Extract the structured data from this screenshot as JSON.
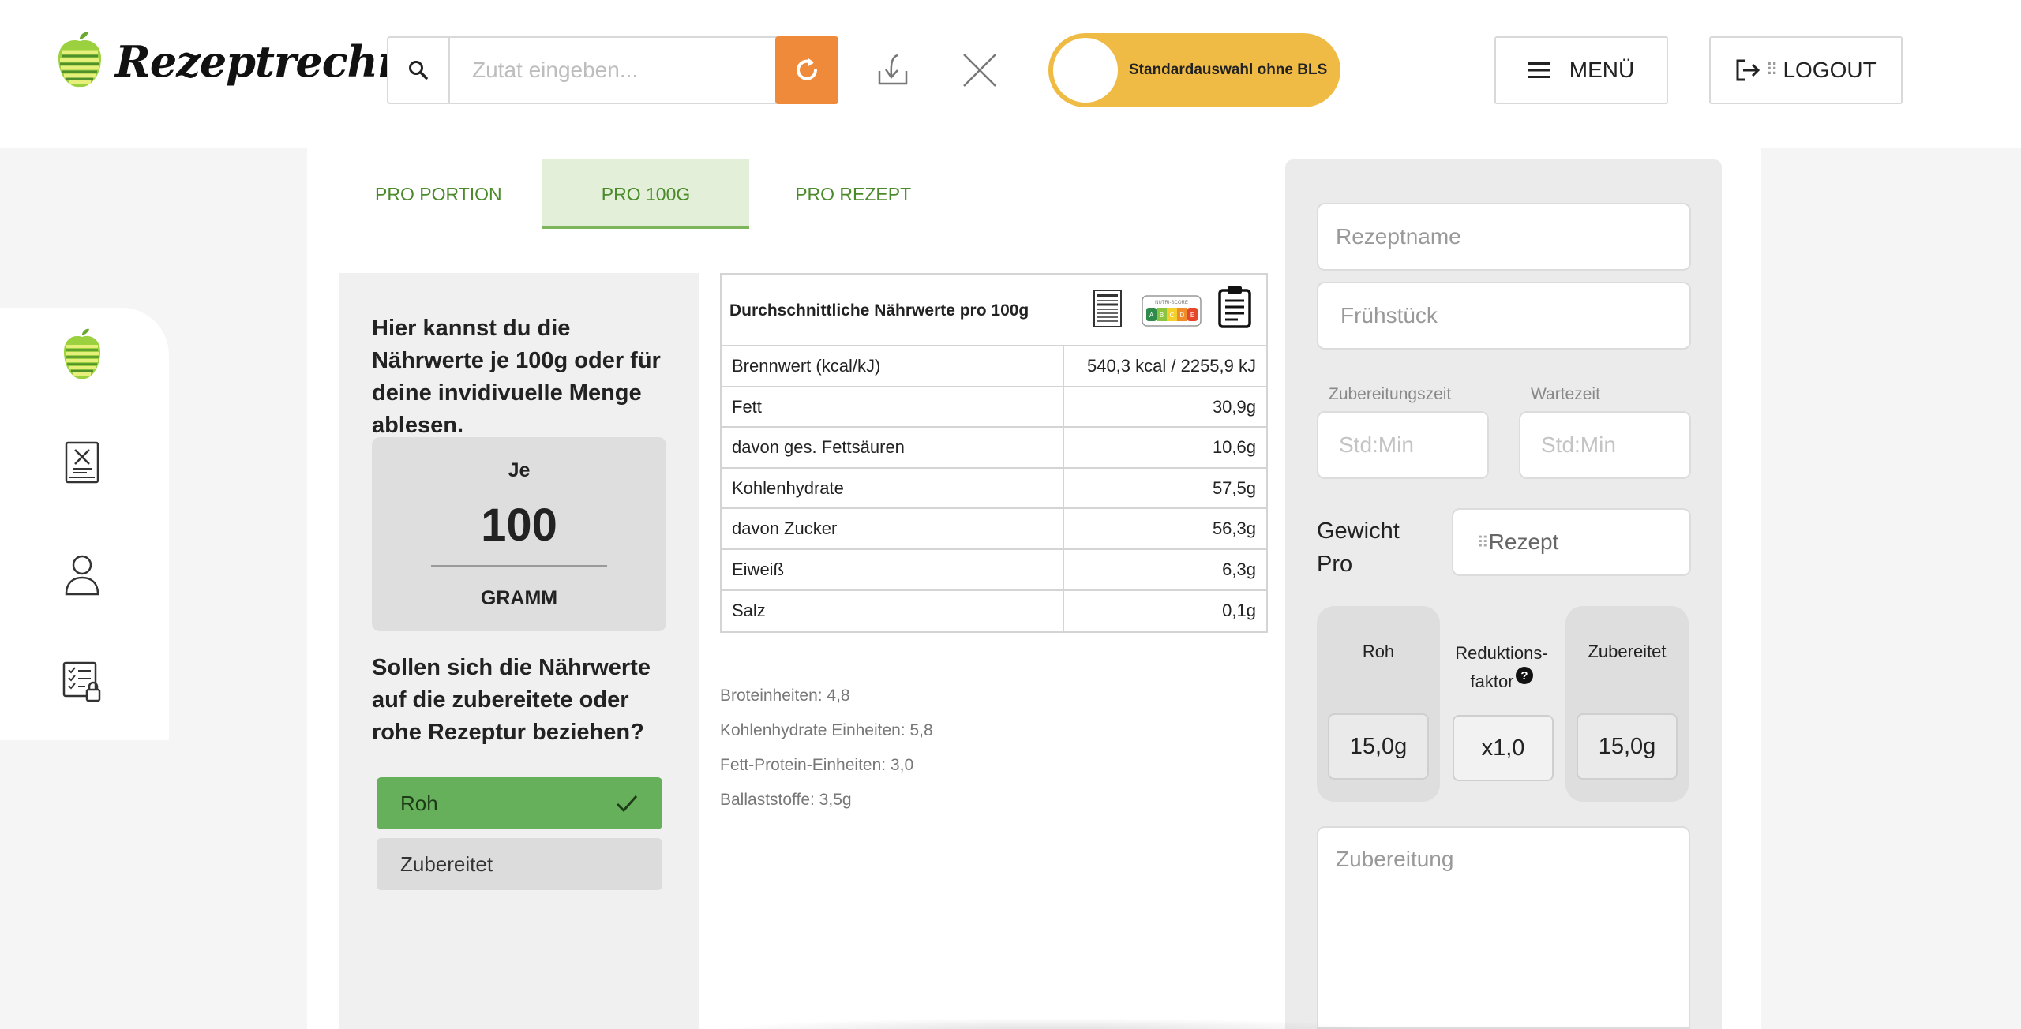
{
  "header": {
    "logo_text": "Rezeptrechner",
    "search": {
      "placeholder": "Zutat eingeben..."
    },
    "toggle_label": "Standardauswahl ohne BLS",
    "menu_label": "MENÜ",
    "logout_label": "LOGOUT",
    "logout_separator": "⠿"
  },
  "sidebar": {
    "items": [
      {
        "icon": "apple-logo-icon"
      },
      {
        "icon": "recipe-book-icon"
      },
      {
        "icon": "user-icon"
      },
      {
        "icon": "checklist-lock-icon"
      }
    ]
  },
  "tabs": [
    {
      "label": "PRO PORTION",
      "active": false
    },
    {
      "label": "PRO 100G",
      "active": true
    },
    {
      "label": "PRO REZEPT",
      "active": false
    }
  ],
  "info": {
    "intro": "Hier kannst du die Nährwerte je 100g oder für deine invidivuelle Menge ablesen.",
    "amount_prefix": "Je",
    "amount_value": "100",
    "amount_unit": "GRAMM",
    "question": "Sollen sich die Nährwerte auf die zubereitete oder rohe Rezeptur beziehen?",
    "option_roh": "Roh",
    "option_zubereitet": "Zubereitet",
    "selected": "Roh"
  },
  "nutrition": {
    "title": "Durchschnittliche Nährwerte pro 100g",
    "rows": [
      {
        "label": "Brennwert (kcal/kJ)",
        "value": "540,3 kcal / 2255,9 kJ"
      },
      {
        "label": "Fett",
        "value": "30,9g"
      },
      {
        "label": "davon ges. Fettsäuren",
        "value": "10,6g"
      },
      {
        "label": "Kohlenhydrate",
        "value": "57,5g"
      },
      {
        "label": "davon Zucker",
        "value": "56,3g"
      },
      {
        "label": "Eiweiß",
        "value": "6,3g"
      },
      {
        "label": "Salz",
        "value": "0,1g"
      }
    ],
    "extras": [
      "Broteinheiten: 4,8",
      "Kohlenhydrate Einheiten: 5,8",
      "Fett-Protein-Einheiten: 3,0",
      "Ballaststoffe: 3,5g"
    ],
    "nutriscore_title": "NUTRI-SCORE",
    "nutriscore_letters": [
      "A",
      "B",
      "C",
      "D",
      "E"
    ]
  },
  "form": {
    "recipe_name_placeholder": "Rezeptname",
    "category_value": "Frühstück",
    "prep_time_label": "Zubereitungszeit",
    "prep_time_placeholder": "Std:Min",
    "wait_time_label": "Wartezeit",
    "wait_time_placeholder": "Std:Min",
    "weight_label_line1": "Gewicht",
    "weight_label_line2": "Pro",
    "weight_select_value": "Rezept",
    "weight_select_prefix": "⠿",
    "raw_title": "Roh",
    "raw_value": "15,0g",
    "reduction_title_line1": "Reduktions-",
    "reduction_title_line2": "faktor",
    "reduction_value": "x1,0",
    "prepared_title": "Zubereitet",
    "prepared_value": "15,0g",
    "preparation_placeholder": "Zubereitung"
  },
  "colors": {
    "accent_orange": "#ee8a3a",
    "toggle_yellow": "#f0bb45",
    "green_selected": "#66b05b",
    "tab_active_bg": "#e3efd9",
    "tab_text_green": "#4a8a2a"
  }
}
